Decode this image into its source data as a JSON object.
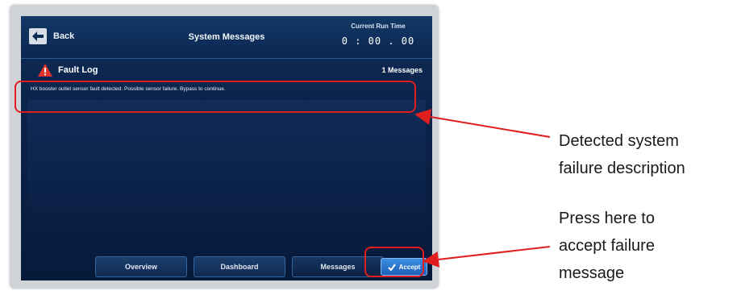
{
  "header": {
    "back_label": "Back",
    "title": "System Messages",
    "runtime_label": "Current Run Time",
    "runtime_value": "0 : 00 . 00"
  },
  "fault_log": {
    "title": "Fault Log",
    "message_count": "1 Messages",
    "messages": [
      "HX booster outlet sensor fault detected. Possible sensor failure. Bypass to continue."
    ]
  },
  "tabs": [
    {
      "label": "Overview"
    },
    {
      "label": "Dashboard"
    },
    {
      "label": "Messages"
    }
  ],
  "accept_button": {
    "label": "Accept"
  },
  "annotations": {
    "description": [
      "Detected system",
      "failure description"
    ],
    "accept": [
      "Press here to",
      "accept failure",
      "message"
    ]
  },
  "colors": {
    "highlight": "#e01e1e",
    "screen_bg": "#0a2148",
    "accent": "#2b74cc",
    "warning": "#e0312b"
  },
  "icons": [
    "back-arrow-icon",
    "warning-triangle-icon",
    "checkmark-icon"
  ]
}
